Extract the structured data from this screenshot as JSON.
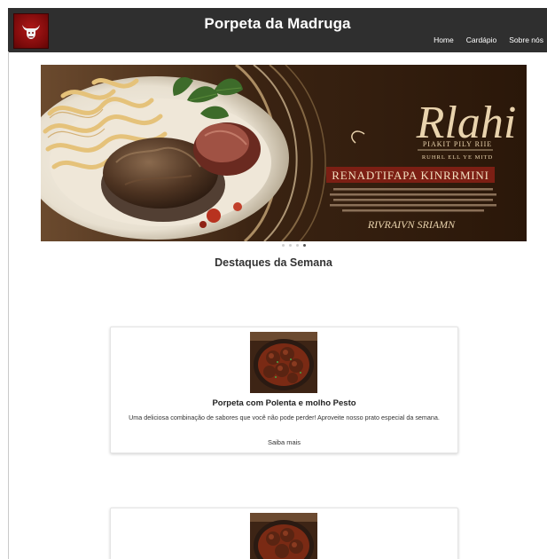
{
  "header": {
    "logo_icon": "bull-head-icon",
    "title": "Porpeta da Madruga",
    "nav": [
      "Home",
      "Cardápio",
      "Sobre nós"
    ]
  },
  "banner": {
    "script_title": "Rlahi",
    "line1": "PIAKIT PILY RIIE",
    "line2": "RUHRL ELL YE MITD",
    "headline": "RENADTIFAPA KINRRMINI",
    "bottom": "RIVRAIVN SRIAMN"
  },
  "carousel": {
    "dot_count": 4,
    "active_index": 3
  },
  "section": {
    "title": "Destaques da Semana"
  },
  "cards": [
    {
      "title": "Porpeta com Polenta e molho Pesto",
      "description": "Uma deliciosa combinação de sabores que você não pode perder! Aproveite nosso prato especial da semana.",
      "link": "Saiba mais"
    },
    {
      "title": "",
      "description": "",
      "link": ""
    }
  ],
  "colors": {
    "header_bg": "#2f2f2f",
    "logo_red": "#9c1010",
    "banner_brown": "#2e1a0d",
    "text_dark": "#333333"
  }
}
